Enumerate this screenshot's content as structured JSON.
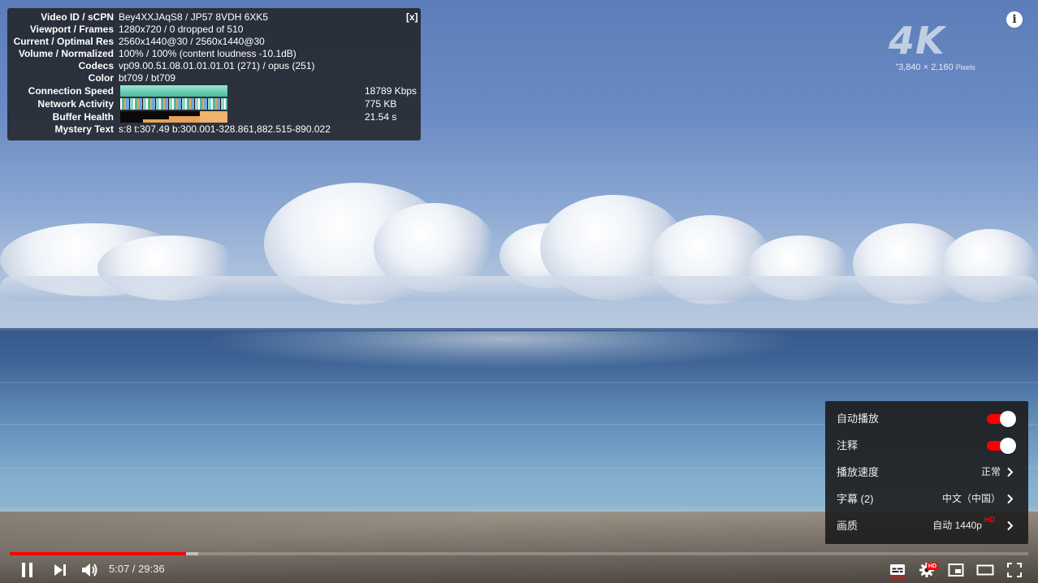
{
  "stats": {
    "close_label": "[x]",
    "rows": [
      {
        "label": "Video ID / sCPN",
        "value": "Bey4XXJAqS8 / JP57 8VDH 6XK5"
      },
      {
        "label": "Viewport / Frames",
        "value": "1280x720 / 0 dropped of 510"
      },
      {
        "label": "Current / Optimal Res",
        "value": "2560x1440@30 / 2560x1440@30"
      },
      {
        "label": "Volume / Normalized",
        "value": "100% / 100% (content loudness -10.1dB)"
      },
      {
        "label": "Codecs",
        "value": "vp09.00.51.08.01.01.01.01 (271) / opus (251)"
      },
      {
        "label": "Color",
        "value": "bt709 / bt709"
      },
      {
        "label": "Connection Speed",
        "value": "18789 Kbps"
      },
      {
        "label": "Network Activity",
        "value": "775 KB"
      },
      {
        "label": "Buffer Health",
        "value": "21.54 s"
      },
      {
        "label": "Mystery Text",
        "value": "s:8 t:307.49 b:300.001-328.861,882.515-890.022"
      }
    ]
  },
  "overlay": {
    "badge": "4K",
    "resolution_star": "*",
    "resolution": "3,840 × 2,160",
    "resolution_unit": "Pixels",
    "info_label": "i"
  },
  "settings_menu": {
    "items": [
      {
        "label": "自动播放",
        "toggle": true,
        "on": true
      },
      {
        "label": "注释",
        "toggle": true,
        "on": true
      },
      {
        "label": "播放速度",
        "value": "正常"
      },
      {
        "label": "字幕 (2)",
        "value": "中文（中国）"
      },
      {
        "label": "画质",
        "value": "自动 1440p",
        "badge": "HD"
      }
    ]
  },
  "player": {
    "current_time": "5:07",
    "duration": "29:36",
    "played_fraction": 0.173,
    "loaded_fraction": 0.185,
    "quality_badge": "HD",
    "icons": [
      "pause-icon",
      "next-icon",
      "volume-icon",
      "subtitles-icon",
      "settings-icon",
      "miniplayer-icon",
      "theater-mode-icon",
      "fullscreen-icon"
    ],
    "colors": {
      "accent": "#ff0000"
    }
  }
}
